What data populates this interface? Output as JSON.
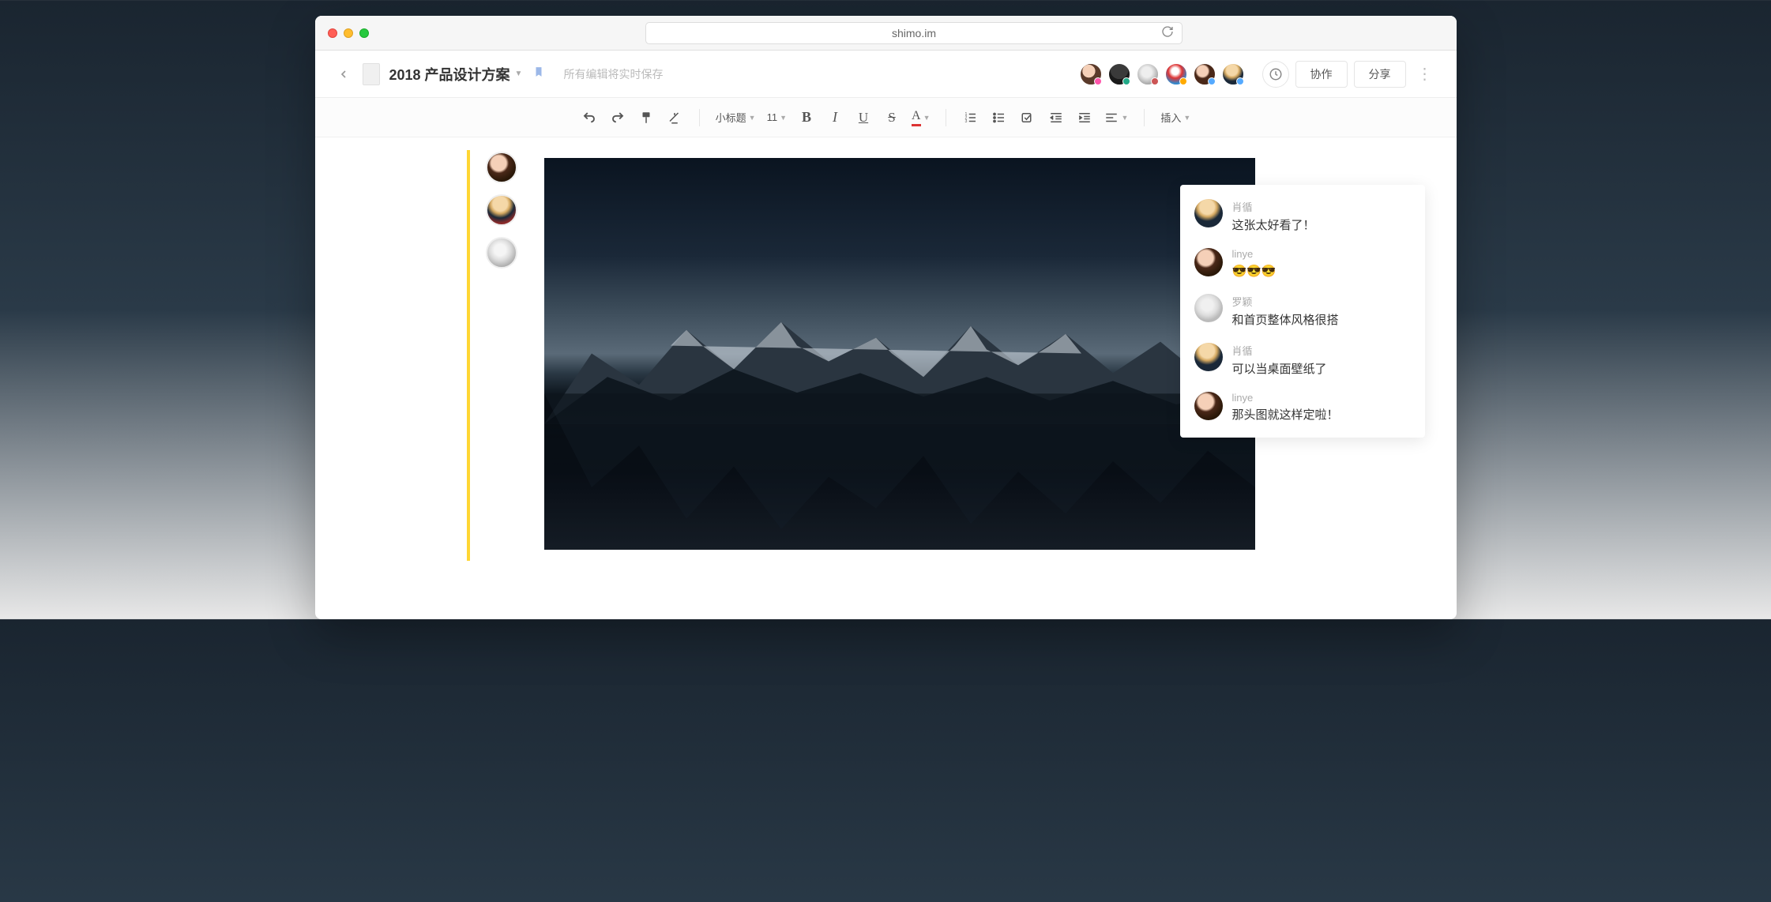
{
  "browser": {
    "url": "shimo.im"
  },
  "header": {
    "doc_title": "2018 产品设计方案",
    "save_status": "所有编辑将实时保存",
    "collaborate_label": "协作",
    "share_label": "分享"
  },
  "toolbar": {
    "heading_label": "小标题",
    "font_size": "11",
    "insert_label": "插入"
  },
  "presence_avatars": [
    {
      "name": "linye"
    },
    {
      "name": "肖循"
    },
    {
      "name": "罗颖"
    }
  ],
  "header_avatars": [
    {
      "name": "user1"
    },
    {
      "name": "user2"
    },
    {
      "name": "user3"
    },
    {
      "name": "user4"
    },
    {
      "name": "user5"
    },
    {
      "name": "user6"
    }
  ],
  "comments": [
    {
      "avatar": "cav-xiao",
      "name": "肖循",
      "text": "这张太好看了！"
    },
    {
      "avatar": "cav-linye",
      "name": "linye",
      "text": "😎😎😎"
    },
    {
      "avatar": "cav-luo",
      "name": "罗颖",
      "text": "和首页整体风格很搭"
    },
    {
      "avatar": "cav-xiao",
      "name": "肖循",
      "text": "可以当桌面壁纸了"
    },
    {
      "avatar": "cav-linye",
      "name": "linye",
      "text": "那头图就这样定啦！"
    }
  ]
}
